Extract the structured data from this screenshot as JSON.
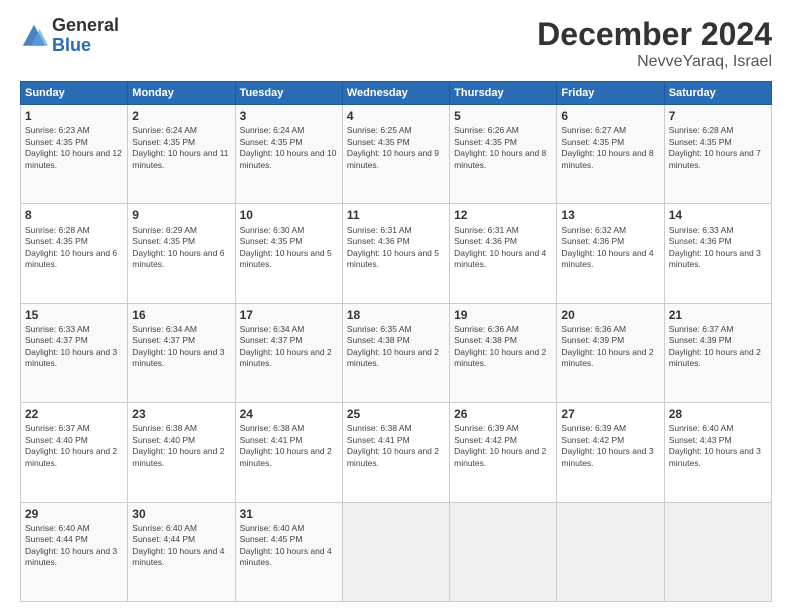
{
  "header": {
    "logo_general": "General",
    "logo_blue": "Blue",
    "month_title": "December 2024",
    "location": "NevveYaraq, Israel"
  },
  "calendar": {
    "days_of_week": [
      "Sunday",
      "Monday",
      "Tuesday",
      "Wednesday",
      "Thursday",
      "Friday",
      "Saturday"
    ],
    "weeks": [
      [
        null,
        {
          "day": 2,
          "sunrise": "6:24 AM",
          "sunset": "4:35 PM",
          "daylight": "10 hours and 11 minutes."
        },
        {
          "day": 3,
          "sunrise": "6:24 AM",
          "sunset": "4:35 PM",
          "daylight": "10 hours and 10 minutes."
        },
        {
          "day": 4,
          "sunrise": "6:25 AM",
          "sunset": "4:35 PM",
          "daylight": "10 hours and 9 minutes."
        },
        {
          "day": 5,
          "sunrise": "6:26 AM",
          "sunset": "4:35 PM",
          "daylight": "10 hours and 8 minutes."
        },
        {
          "day": 6,
          "sunrise": "6:27 AM",
          "sunset": "4:35 PM",
          "daylight": "10 hours and 8 minutes."
        },
        {
          "day": 7,
          "sunrise": "6:28 AM",
          "sunset": "4:35 PM",
          "daylight": "10 hours and 7 minutes."
        }
      ],
      [
        {
          "day": 1,
          "sunrise": "6:23 AM",
          "sunset": "4:35 PM",
          "daylight": "10 hours and 12 minutes."
        },
        {
          "day": 9,
          "sunrise": "6:29 AM",
          "sunset": "4:35 PM",
          "daylight": "10 hours and 6 minutes."
        },
        {
          "day": 10,
          "sunrise": "6:30 AM",
          "sunset": "4:35 PM",
          "daylight": "10 hours and 5 minutes."
        },
        {
          "day": 11,
          "sunrise": "6:31 AM",
          "sunset": "4:36 PM",
          "daylight": "10 hours and 5 minutes."
        },
        {
          "day": 12,
          "sunrise": "6:31 AM",
          "sunset": "4:36 PM",
          "daylight": "10 hours and 4 minutes."
        },
        {
          "day": 13,
          "sunrise": "6:32 AM",
          "sunset": "4:36 PM",
          "daylight": "10 hours and 4 minutes."
        },
        {
          "day": 14,
          "sunrise": "6:33 AM",
          "sunset": "4:36 PM",
          "daylight": "10 hours and 3 minutes."
        }
      ],
      [
        {
          "day": 8,
          "sunrise": "6:28 AM",
          "sunset": "4:35 PM",
          "daylight": "10 hours and 6 minutes."
        },
        {
          "day": 16,
          "sunrise": "6:34 AM",
          "sunset": "4:37 PM",
          "daylight": "10 hours and 3 minutes."
        },
        {
          "day": 17,
          "sunrise": "6:34 AM",
          "sunset": "4:37 PM",
          "daylight": "10 hours and 2 minutes."
        },
        {
          "day": 18,
          "sunrise": "6:35 AM",
          "sunset": "4:38 PM",
          "daylight": "10 hours and 2 minutes."
        },
        {
          "day": 19,
          "sunrise": "6:36 AM",
          "sunset": "4:38 PM",
          "daylight": "10 hours and 2 minutes."
        },
        {
          "day": 20,
          "sunrise": "6:36 AM",
          "sunset": "4:39 PM",
          "daylight": "10 hours and 2 minutes."
        },
        {
          "day": 21,
          "sunrise": "6:37 AM",
          "sunset": "4:39 PM",
          "daylight": "10 hours and 2 minutes."
        }
      ],
      [
        {
          "day": 15,
          "sunrise": "6:33 AM",
          "sunset": "4:37 PM",
          "daylight": "10 hours and 3 minutes."
        },
        {
          "day": 23,
          "sunrise": "6:38 AM",
          "sunset": "4:40 PM",
          "daylight": "10 hours and 2 minutes."
        },
        {
          "day": 24,
          "sunrise": "6:38 AM",
          "sunset": "4:41 PM",
          "daylight": "10 hours and 2 minutes."
        },
        {
          "day": 25,
          "sunrise": "6:38 AM",
          "sunset": "4:41 PM",
          "daylight": "10 hours and 2 minutes."
        },
        {
          "day": 26,
          "sunrise": "6:39 AM",
          "sunset": "4:42 PM",
          "daylight": "10 hours and 2 minutes."
        },
        {
          "day": 27,
          "sunrise": "6:39 AM",
          "sunset": "4:42 PM",
          "daylight": "10 hours and 3 minutes."
        },
        {
          "day": 28,
          "sunrise": "6:40 AM",
          "sunset": "4:43 PM",
          "daylight": "10 hours and 3 minutes."
        }
      ],
      [
        {
          "day": 22,
          "sunrise": "6:37 AM",
          "sunset": "4:40 PM",
          "daylight": "10 hours and 2 minutes."
        },
        {
          "day": 30,
          "sunrise": "6:40 AM",
          "sunset": "4:44 PM",
          "daylight": "10 hours and 4 minutes."
        },
        {
          "day": 31,
          "sunrise": "6:40 AM",
          "sunset": "4:45 PM",
          "daylight": "10 hours and 4 minutes."
        },
        null,
        null,
        null,
        null
      ],
      [
        {
          "day": 29,
          "sunrise": "6:40 AM",
          "sunset": "4:44 PM",
          "daylight": "10 hours and 3 minutes."
        },
        null,
        null,
        null,
        null,
        null,
        null
      ]
    ]
  }
}
